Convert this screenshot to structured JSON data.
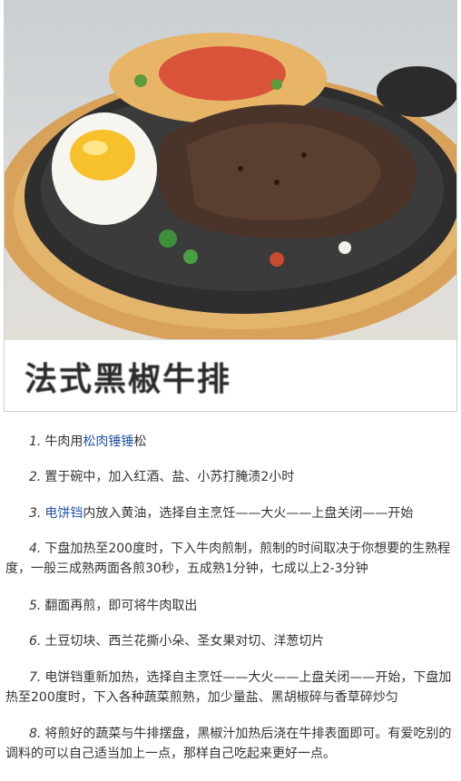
{
  "image": {
    "caption": "法式黑椒牛排",
    "alt_icon": "steak-photo"
  },
  "steps": [
    {
      "num": "1.",
      "pre": "牛肉用",
      "link": "松肉锤锤",
      "post": "松"
    },
    {
      "num": "2.",
      "pre": "置于碗中，加入红酒、盐、小苏打腌渍2小时",
      "link": "",
      "post": ""
    },
    {
      "num": "3.",
      "pre": "",
      "link": "电饼铛",
      "post": "内放入黄油，选择自主烹饪——大火——上盘关闭——开始"
    },
    {
      "num": "4.",
      "pre": "下盘加热至200度时，下入牛肉煎制，煎制的时间取决于你想要的生熟程度，一般三成熟两面各煎30秒，五成熟1分钟，七成以上2-3分钟",
      "link": "",
      "post": ""
    },
    {
      "num": "5.",
      "pre": "翻面再煎，即可将牛肉取出",
      "link": "",
      "post": ""
    },
    {
      "num": "6.",
      "pre": "土豆切块、西兰花撕小朵、圣女果对切、洋葱切片",
      "link": "",
      "post": ""
    },
    {
      "num": "7.",
      "pre": "电饼铛重新加热，选择自主烹饪——大火——上盘关闭——开始，下盘加热至200度时，下入各种蔬菜煎熟，加少量盐、黑胡椒碎与香草碎炒匀",
      "link": "",
      "post": ""
    },
    {
      "num": "8.",
      "pre": "将煎好的蔬菜与牛排摆盘，黑椒汁加热后浇在牛排表面即可。有爱吃别的调料的可以自己适当加上一点，那样自己吃起来更好一点。",
      "link": "",
      "post": ""
    }
  ],
  "colors": {
    "link": "#2255aa",
    "text": "#333333"
  }
}
